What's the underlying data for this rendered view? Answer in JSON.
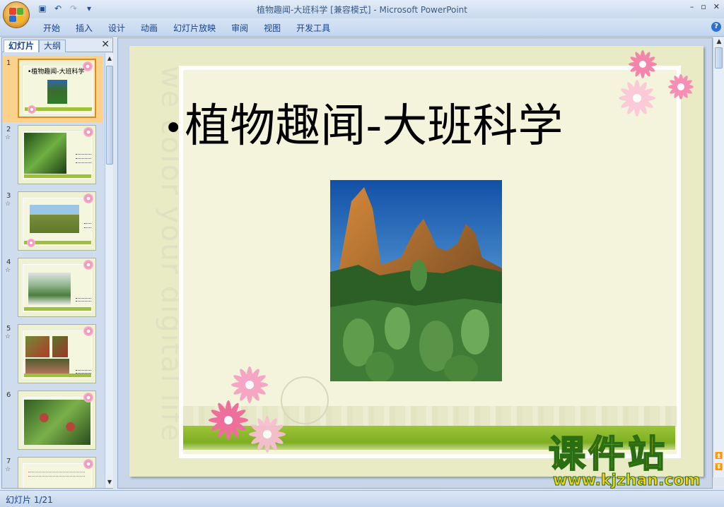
{
  "window": {
    "title": "植物趣闻-大班科学 [兼容模式] - Microsoft PowerPoint",
    "controls": [
      "–",
      "▫",
      "✕"
    ]
  },
  "quick_access": {
    "icons": [
      "save-icon",
      "undo-icon",
      "redo-icon",
      "customize-icon"
    ]
  },
  "menu": {
    "items": [
      "开始",
      "插入",
      "设计",
      "动画",
      "幻灯片放映",
      "审阅",
      "视图",
      "开发工具"
    ]
  },
  "panel": {
    "tabs": [
      "幻灯片",
      "大纲"
    ],
    "thumbnails": [
      {
        "number": "1",
        "title": "•植物趣闻-大班科学",
        "selected": true
      },
      {
        "number": "2",
        "title": "",
        "selected": false
      },
      {
        "number": "3",
        "title": "",
        "selected": false
      },
      {
        "number": "4",
        "title": "",
        "selected": false
      },
      {
        "number": "5",
        "title": "",
        "selected": false
      },
      {
        "number": "6",
        "title": "",
        "selected": false
      },
      {
        "number": "7",
        "title": "",
        "selected": false
      }
    ]
  },
  "slide": {
    "bullet": "•",
    "title": "植物趣闻-大班科学",
    "watermark_text": "we color your digital life"
  },
  "watermark": {
    "main": "课件站",
    "url": "www.kjzhan.com"
  },
  "status": {
    "slide_counter": "幻灯片 1/21"
  },
  "colors": {
    "accent": "#15428b",
    "selection": "#fbd18c",
    "grass": "#9cc43a",
    "slide_bg": "#e8ebc4"
  }
}
